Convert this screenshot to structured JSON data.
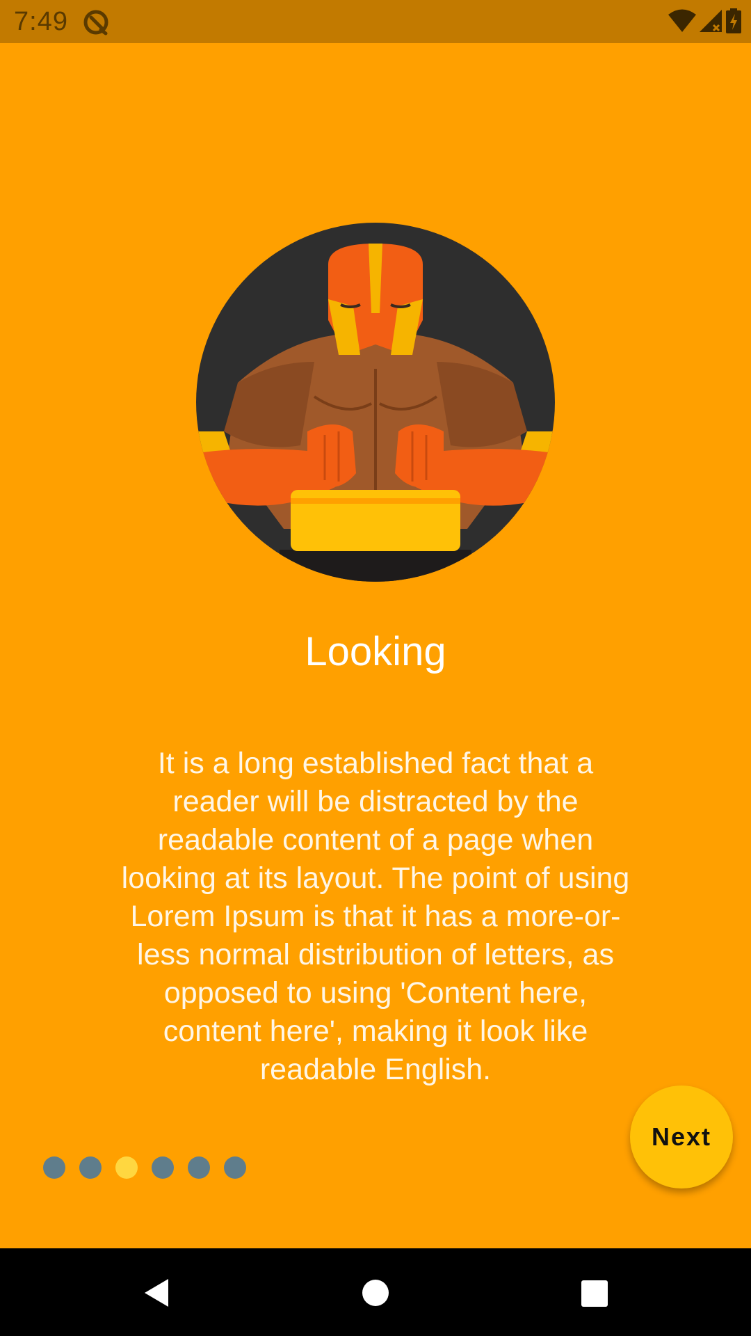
{
  "status_bar": {
    "time": "7:49",
    "icons": [
      "app-notification-icon",
      "wifi-icon",
      "cellular-signal-icon",
      "battery-charging-icon"
    ],
    "bg_color": "#C27A00"
  },
  "onboarding": {
    "title": "Looking",
    "description": "It is a long established fact that a reader will be distracted by the readable content of a page when looking at its layout. The point of using Lorem Ipsum is that it has a more-or-less normal distribution of letters, as opposed to using 'Content here, content here', making it look like readable English.",
    "illustration_icon": "masked-wrestler-illustration",
    "bg_color": "#FFA000"
  },
  "pager": {
    "total_pages": 6,
    "current_page": 3,
    "dot_color": "#5F7D8C",
    "active_dot_color": "#FFD740"
  },
  "next_button": {
    "label": "Next",
    "color": "#FFC107"
  },
  "nav_bar": {
    "icons": [
      "back-icon",
      "home-icon",
      "recents-icon"
    ]
  }
}
